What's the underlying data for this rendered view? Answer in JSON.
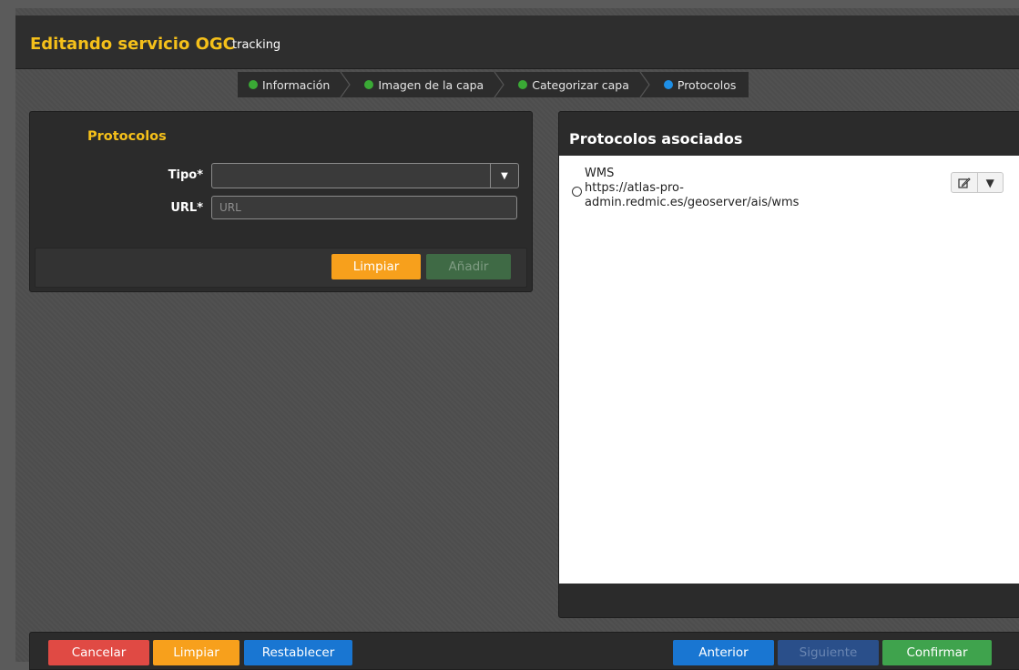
{
  "header": {
    "title": "Editando servicio OGC",
    "subtitle": "tracking"
  },
  "steps": [
    {
      "label": "Información",
      "status_color": "#3aa935"
    },
    {
      "label": "Imagen de la capa",
      "status_color": "#3aa935"
    },
    {
      "label": "Categorizar capa",
      "status_color": "#3aa935"
    },
    {
      "label": "Protocolos",
      "status_color": "#1e8fe6"
    }
  ],
  "form": {
    "title": "Protocolos",
    "tipo_label": "Tipo*",
    "tipo_value": "",
    "url_label": "URL*",
    "url_placeholder": "URL",
    "url_value": "",
    "clear_label": "Limpiar",
    "add_label": "Añadir"
  },
  "associated": {
    "title": "Protocolos asociados",
    "items": [
      {
        "type": "WMS",
        "url_line1": "https://atlas-pro-",
        "url_line2": "admin.redmic.es/geoserver/ais/wms"
      }
    ]
  },
  "footer": {
    "cancel_label": "Cancelar",
    "clear_label": "Limpiar",
    "reset_label": "Restablecer",
    "previous_label": "Anterior",
    "next_label": "Siguiente",
    "confirm_label": "Confirmar"
  },
  "colors": {
    "accent_yellow": "#f5c01a",
    "cancel_red": "#e04a44",
    "clear_orange": "#f7a01c",
    "blue": "#1976d2",
    "blue_disabled": "#2a4f8a",
    "green": "#3fa34d",
    "green_disabled": "#3f6a45"
  }
}
